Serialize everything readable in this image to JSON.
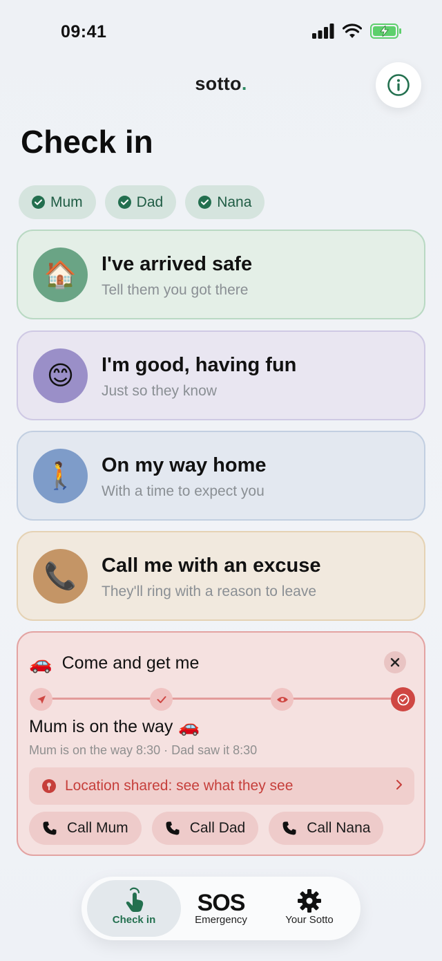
{
  "status_bar": {
    "time": "09:41"
  },
  "header": {
    "logo": "sotto",
    "logo_dot": "."
  },
  "page": {
    "title": "Check in"
  },
  "recipients": [
    {
      "name": "Mum"
    },
    {
      "name": "Dad"
    },
    {
      "name": "Nana"
    }
  ],
  "cards": {
    "arrived": {
      "emoji": "🏠",
      "title": "I've arrived safe",
      "subtitle": "Tell them you got there"
    },
    "good": {
      "emoji": "😊",
      "title": "I'm good, having fun",
      "subtitle": "Just so they know"
    },
    "home": {
      "emoji": "🚶",
      "title": "On my way home",
      "subtitle": "With a time to expect you"
    },
    "excuse": {
      "emoji": "📞",
      "title": "Call me with an excuse",
      "subtitle": "They'll ring with a reason to leave"
    }
  },
  "pickup": {
    "emoji": "🚗",
    "title": "Come and get me",
    "status": "Mum is on the way",
    "status_emoji": "🚗",
    "meta": "Mum is on the way 8:30 · Dad saw it 8:30",
    "location": "Location shared: see what they see",
    "calls": [
      {
        "label": "Call Mum"
      },
      {
        "label": "Call Dad"
      },
      {
        "label": "Call Nana"
      }
    ]
  },
  "nav": {
    "checkin": "Check in",
    "sos_title": "SOS",
    "sos": "Emergency",
    "settings": "Your Sotto"
  },
  "colors": {
    "accent": "#23704f",
    "danger": "#cf4743"
  }
}
